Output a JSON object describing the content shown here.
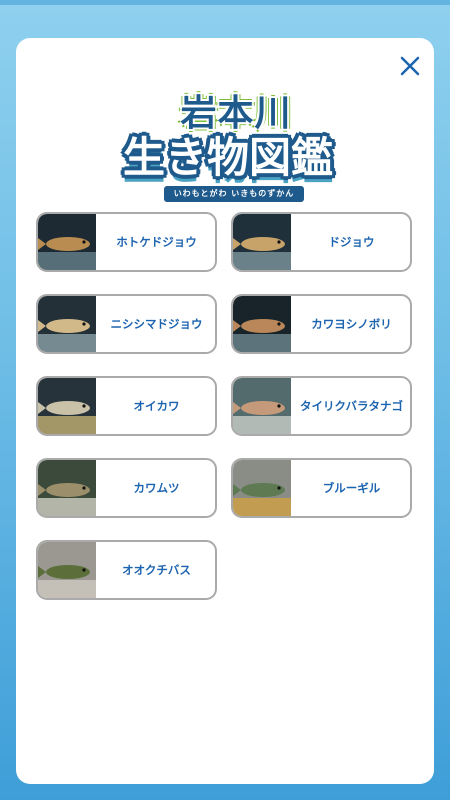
{
  "header": {
    "logo_title": "岩本川",
    "logo_subtitle": "生き物図鑑",
    "logo_reading": "いわもとがわ いきものずかん",
    "close_icon": "close-icon"
  },
  "species": [
    {
      "name": "ホトケドジョウ",
      "image": "loach-photo",
      "colors": [
        "#1e2a33",
        "#b98d52",
        "#6e8b94"
      ]
    },
    {
      "name": "ドジョウ",
      "image": "loach-photo",
      "colors": [
        "#20303a",
        "#c7a36a",
        "#8aa4ad"
      ]
    },
    {
      "name": "ニシシマドジョウ",
      "image": "striped-loach-photo",
      "colors": [
        "#233038",
        "#d1b98a",
        "#9ab0b8"
      ]
    },
    {
      "name": "カワヨシノボリ",
      "image": "goby-photo",
      "colors": [
        "#18232a",
        "#b9875a",
        "#7b969e"
      ]
    },
    {
      "name": "オイカワ",
      "image": "minnow-photo",
      "colors": [
        "#26333a",
        "#c9c1a8",
        "#d9c27a"
      ]
    },
    {
      "name": "タイリクバラタナゴ",
      "image": "bitterling-photo",
      "colors": [
        "#546b6e",
        "#c49a7a",
        "#d8dcd2"
      ]
    },
    {
      "name": "カワムツ",
      "image": "dark-chub-photo",
      "colors": [
        "#3c4a3c",
        "#9b8e6a",
        "#e6e2d6"
      ]
    },
    {
      "name": "ブルーギル",
      "image": "bluegill-photo",
      "colors": [
        "#8a8c86",
        "#5e7a52",
        "#d9a33a"
      ]
    },
    {
      "name": "オオクチバス",
      "image": "bass-photo",
      "colors": [
        "#9a9890",
        "#5c6e3a",
        "#d6d2c8"
      ]
    }
  ]
}
